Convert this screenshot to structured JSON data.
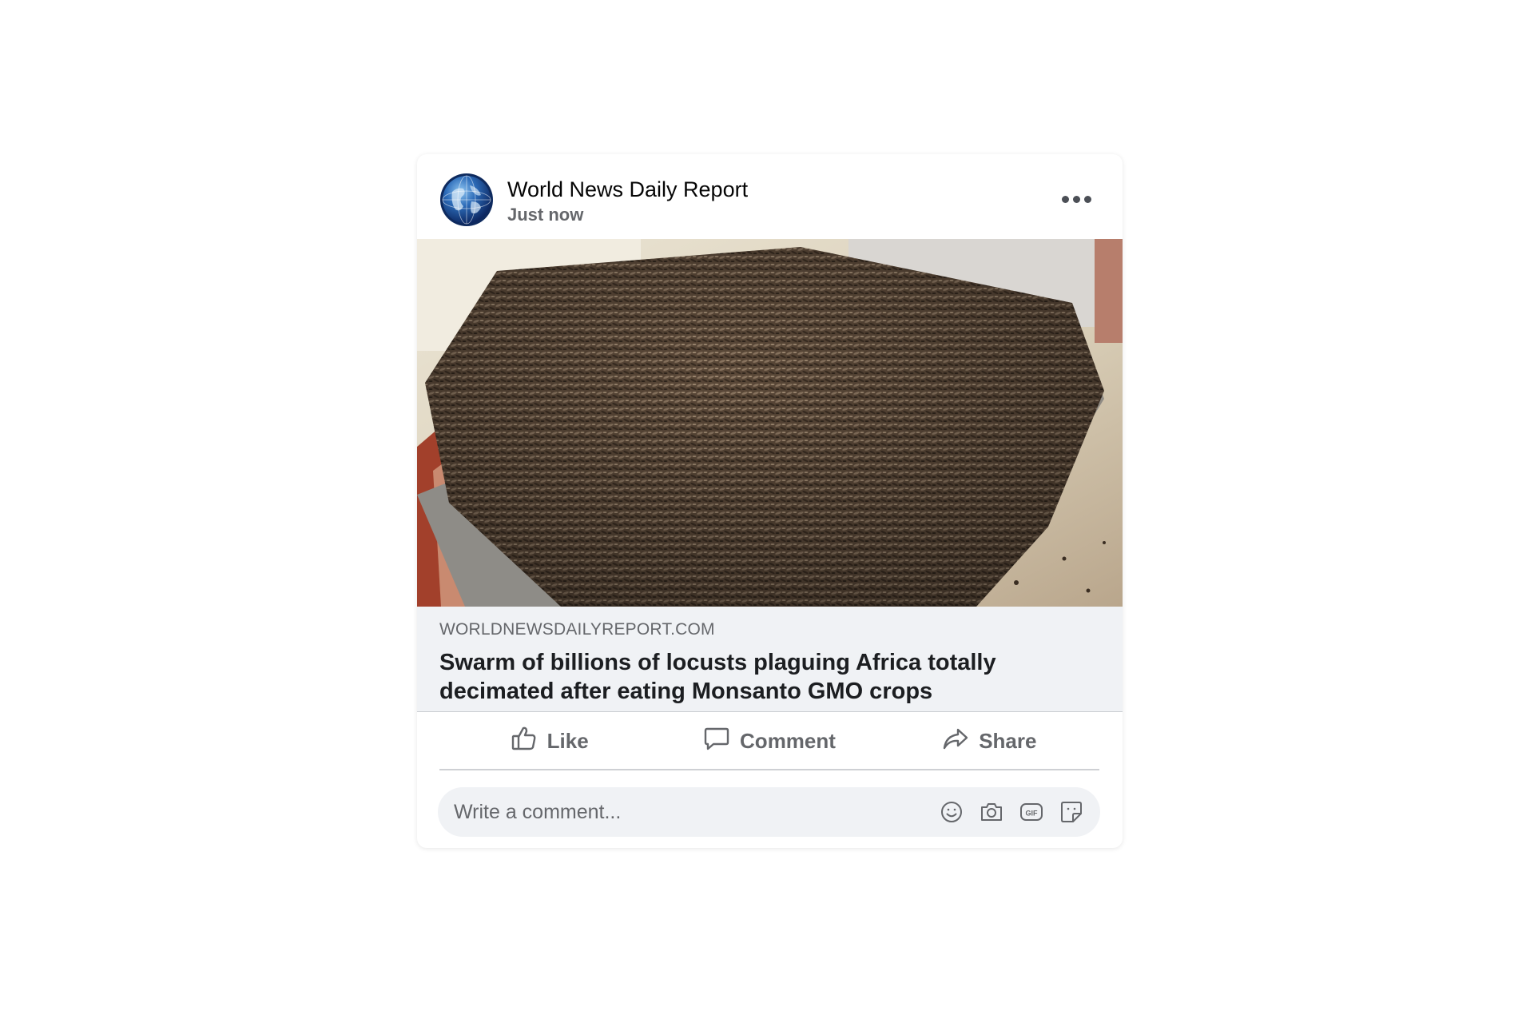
{
  "post": {
    "author_name": "World News Daily Report",
    "timestamp": "Just now",
    "avatar_icon": "globe-icon",
    "more_icon": "more-options-icon"
  },
  "link_preview": {
    "domain": "WORLDNEWSDAILYREPORT.COM",
    "title": "Swarm of billions of locusts plaguing Africa totally decimated after eating Monsanto GMO crops"
  },
  "actions": {
    "like_label": "Like",
    "comment_label": "Comment",
    "share_label": "Share"
  },
  "comment_box": {
    "placeholder": "Write a comment...",
    "tools": [
      "emoji-icon",
      "camera-icon",
      "gif-icon",
      "sticker-icon"
    ]
  },
  "colors": {
    "background": "#ffffff",
    "preview_bg": "#f0f2f5",
    "secondary_text": "#65676b",
    "primary_text": "#050505"
  }
}
